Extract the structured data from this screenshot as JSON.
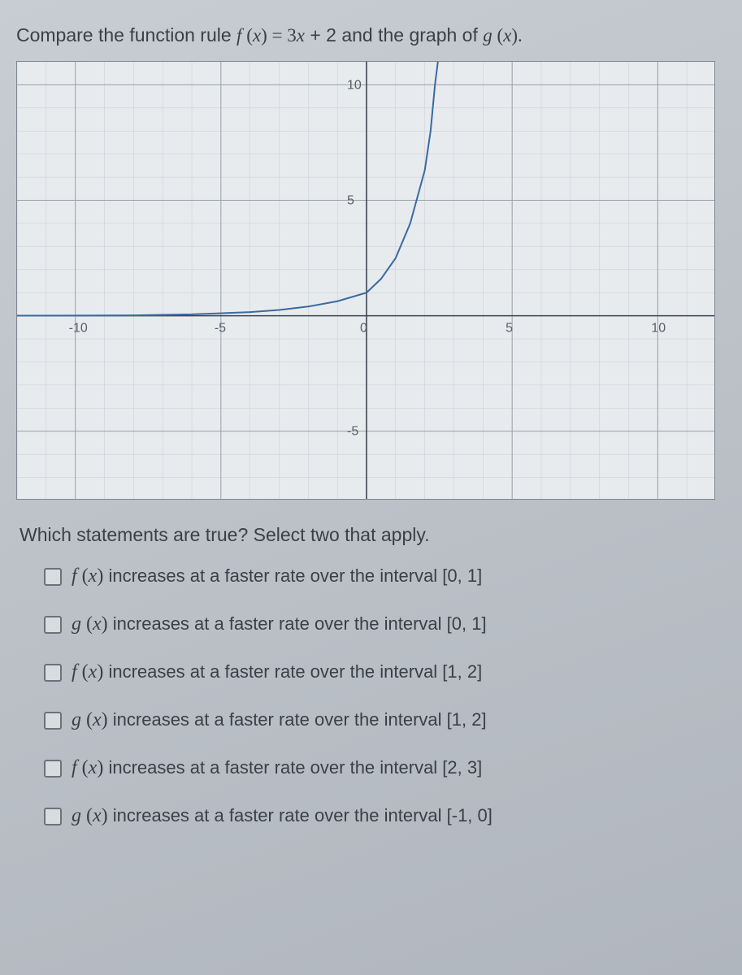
{
  "prompt": {
    "pre": "Compare the function rule ",
    "fexpr_f": "f",
    "fexpr_open": " (",
    "fexpr_x": "x",
    "fexpr_close": ") = 3",
    "fexpr_x2": "x",
    "fexpr_plus": " + 2 and the graph of ",
    "fexpr_g": "g",
    "fexpr_open2": " (",
    "fexpr_x3": "x",
    "fexpr_close2": ").",
    "question2": "Which statements are true?  Select two that apply."
  },
  "chart_data": {
    "type": "line",
    "title": "",
    "xlabel": "",
    "ylabel": "",
    "xlim": [
      -12,
      12
    ],
    "ylim": [
      -8,
      11
    ],
    "xticks": [
      -10,
      -5,
      0,
      5,
      10
    ],
    "yticks": [
      -5,
      5,
      10
    ],
    "series": [
      {
        "name": "g(x)",
        "x": [
          -12,
          -10,
          -8,
          -6,
          -4,
          -3,
          -2,
          -1,
          0,
          0.5,
          1,
          1.5,
          2,
          2.2,
          2.35,
          2.45
        ],
        "y": [
          0.0039,
          0.01,
          0.02,
          0.06,
          0.16,
          0.25,
          0.4,
          0.63,
          1,
          1.6,
          2.5,
          4,
          6.3,
          8,
          10,
          11
        ]
      }
    ]
  },
  "options": [
    {
      "f": "f",
      "txt": " increases at a faster rate over the interval [0, 1]"
    },
    {
      "f": "g",
      "txt": " increases at a faster rate over the interval [0, 1]"
    },
    {
      "f": "f",
      "txt": " increases at a faster rate over the interval [1, 2]"
    },
    {
      "f": "g",
      "txt": " increases at a faster rate over the interval [1, 2]"
    },
    {
      "f": "f",
      "txt": " increases at a faster rate over the interval [2, 3]"
    },
    {
      "f": "g",
      "txt": " increases at a faster rate over the interval [-1, 0]"
    }
  ]
}
